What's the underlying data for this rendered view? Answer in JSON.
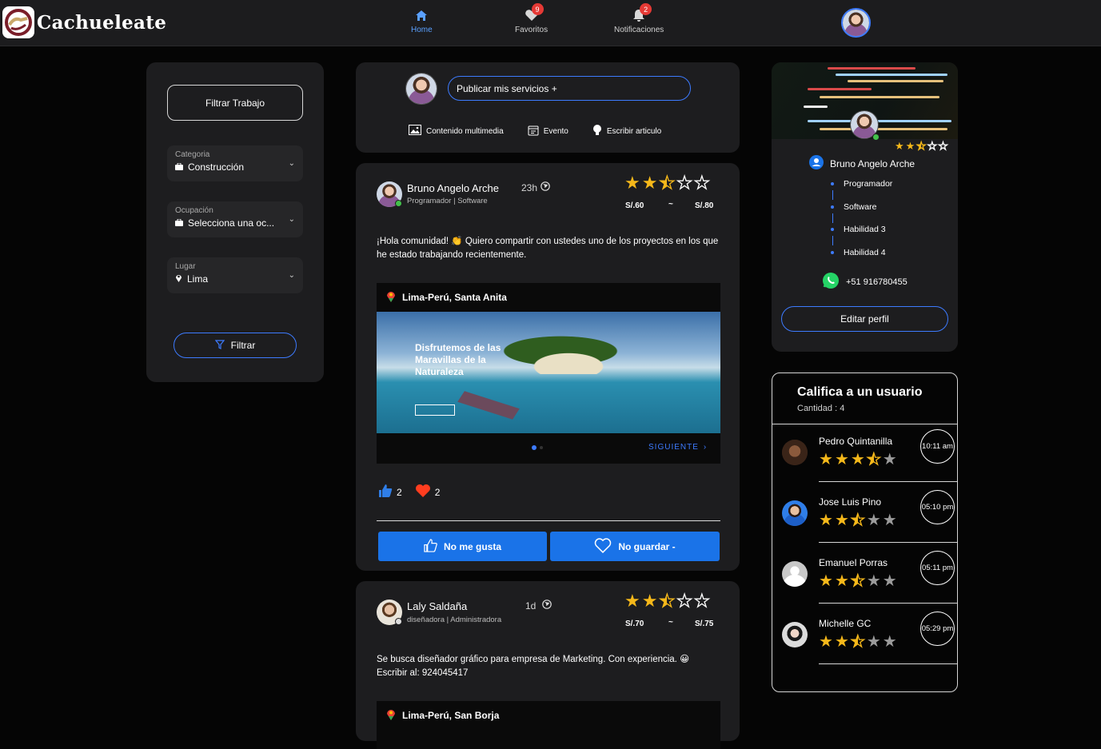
{
  "brand": {
    "name": "Cachueleate"
  },
  "nav": [
    {
      "label": "Home",
      "badge": ""
    },
    {
      "label": "Favoritos",
      "badge": "9"
    },
    {
      "label": "Notificaciones",
      "badge": "2"
    }
  ],
  "filters": {
    "title_button": "Filtrar Trabajo",
    "categoria": {
      "label": "Categoria",
      "value": "Construcción"
    },
    "ocupacion": {
      "label": "Ocupación",
      "value": "Selecciona una oc..."
    },
    "lugar": {
      "label": "Lugar",
      "value": "Lima"
    },
    "submit": "Filtrar"
  },
  "composer": {
    "placeholder": "Publicar mis servicios +",
    "actions": [
      "Contenido multimedia",
      "Evento",
      "Escribir articulo"
    ]
  },
  "posts": [
    {
      "author": "Bruno Angelo Arche",
      "time": "23h",
      "subtitle": "Programador | Software",
      "rating": 2.5,
      "price_min": "S/.60",
      "price_sep": "~",
      "price_max": "S/.80",
      "text": "¡Hola comunidad! 👏 Quiero compartir con ustedes uno de los proyectos en los que he estado trabajando recientemente.",
      "location": "Lima-Perú, Santa Anita",
      "media_headline": "Disfrutemos de las Maravillas de la Naturaleza",
      "media_next": "SIGUIENTE",
      "likes": "2",
      "hearts": "2",
      "like_button": "No me gusta",
      "save_button": "No guardar -"
    },
    {
      "author": "Laly Saldaña",
      "time": "1d",
      "subtitle": "diseñadora | Administradora",
      "rating": 2.5,
      "price_min": "S/.70",
      "price_sep": "~",
      "price_max": "S/.75",
      "text": "Se busca diseñador gráfico para empresa de Marketing. Con experiencia. 😀 Escribir al: 924045417",
      "location": "Lima-Perú, San Borja"
    }
  ],
  "profile": {
    "name": "Bruno Angelo Arche",
    "rating": 2.5,
    "skills": [
      "Programador",
      "Software",
      "Habilidad 3",
      "Habilidad 4"
    ],
    "phone": "+51 916780455",
    "edit_button": "Editar perfil"
  },
  "rate_users": {
    "title": "Califica a un usuario",
    "count_label": "Cantidad : 4",
    "users": [
      {
        "name": "Pedro Quintanilla",
        "rating": 3.5,
        "time": "10:11 am"
      },
      {
        "name": "Jose Luis Pino",
        "rating": 2.5,
        "time": "05:10 pm"
      },
      {
        "name": "Emanuel Porras",
        "rating": 2.5,
        "time": "05:11 pm"
      },
      {
        "name": "Michelle GC",
        "rating": 2.5,
        "time": "05:29 pm"
      }
    ]
  },
  "colors": {
    "accent": "#3d7bff",
    "button_blue": "#1a73e8",
    "star": "#f5b81a",
    "panel": "#1d1d1f",
    "online": "#43c04b"
  }
}
